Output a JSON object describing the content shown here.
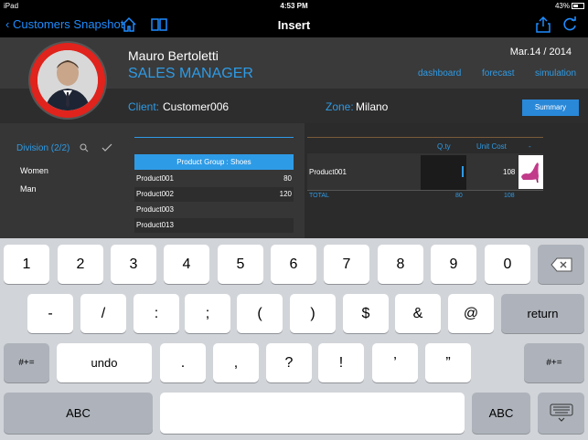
{
  "status": {
    "device": "iPad",
    "time": "4:53 PM",
    "battery": "43%"
  },
  "nav": {
    "back_label": "Customers Snapshot",
    "title": "Insert"
  },
  "profile": {
    "name": "Mauro Bertoletti",
    "role": "SALES MANAGER",
    "date": "Mar.14 / 2014"
  },
  "links": {
    "dashboard": "dashboard",
    "forecast": "forecast",
    "simulation": "simulation"
  },
  "client": {
    "label": "Client:",
    "value": "Customer006",
    "zone_label": "Zone:",
    "zone_value": "Milano",
    "summary": "Summary"
  },
  "division": {
    "title": "Division (2/2)",
    "items": [
      "Women",
      "Man"
    ]
  },
  "product_group": {
    "header": "Product Group : Shoes",
    "rows": [
      {
        "name": "Product001",
        "value": "80"
      },
      {
        "name": "Product002",
        "value": "120"
      },
      {
        "name": "Product003",
        "value": ""
      },
      {
        "name": "Product013",
        "value": ""
      }
    ]
  },
  "order": {
    "col_qty": "Q.ty",
    "col_unit_cost": "Unit Cost",
    "col_extra": "-",
    "product": "Product001",
    "qty": "",
    "unit_cost": "108",
    "total_label": "TOTAL",
    "total_qty": "80",
    "total_cost": "108"
  },
  "keyboard": {
    "row1": [
      "1",
      "2",
      "3",
      "4",
      "5",
      "6",
      "7",
      "8",
      "9",
      "0"
    ],
    "row2": [
      "-",
      "/",
      ":",
      ";",
      "(",
      ")",
      "$",
      "&",
      "@"
    ],
    "return": "return",
    "row3": [
      "#+=",
      "undo",
      ".",
      ",",
      "?",
      "!",
      "’",
      "”",
      "#+="
    ],
    "abc": "ABC"
  },
  "colors": {
    "accent": "#2e9be6",
    "avatar_ring": "#e0231c"
  }
}
